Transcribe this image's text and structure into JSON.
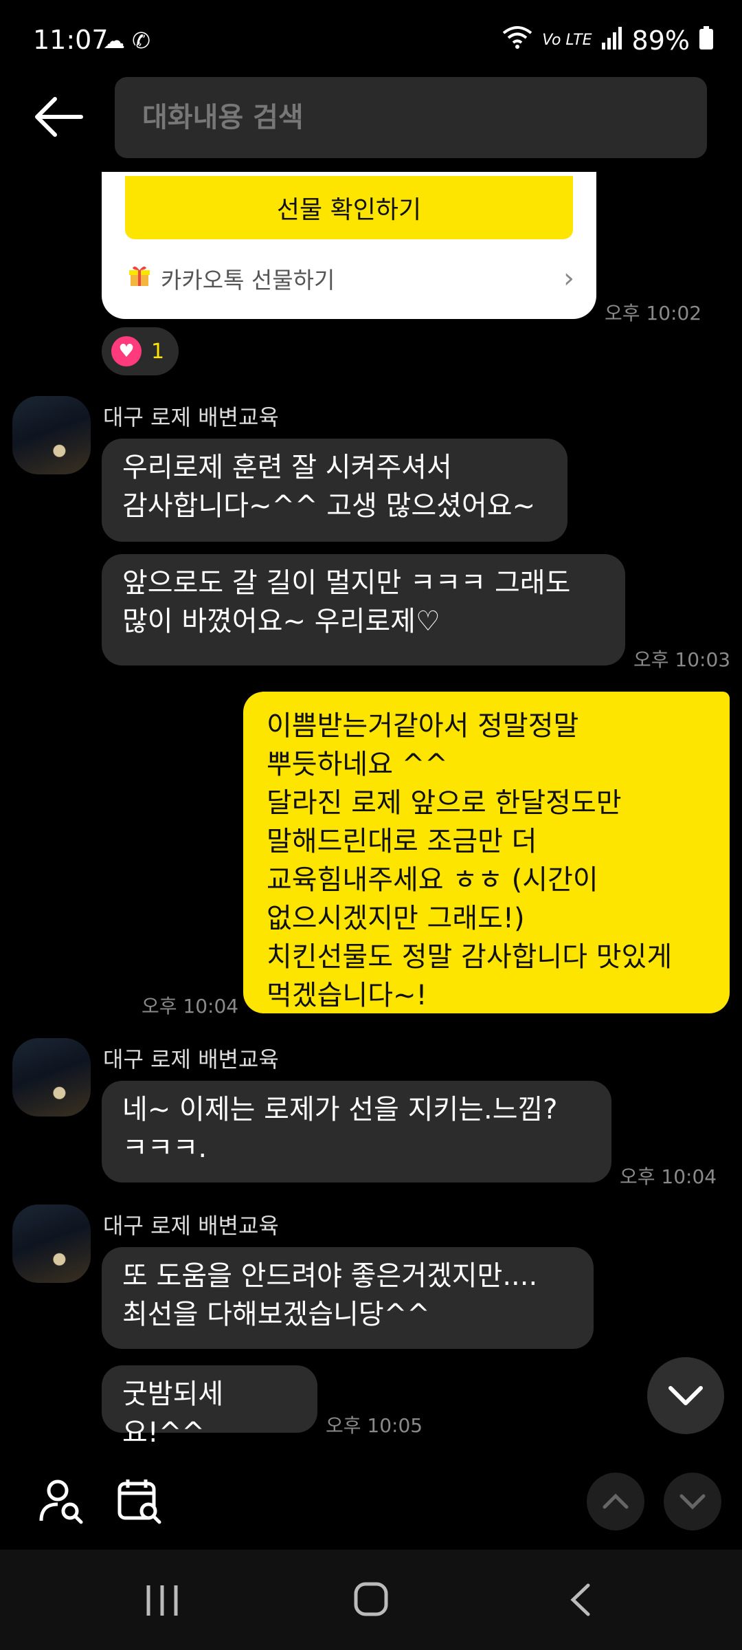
{
  "status": {
    "time": "11:07",
    "battery": "89%",
    "network": "Vo LTE"
  },
  "search": {
    "placeholder": "대화내용 검색"
  },
  "gift": {
    "button_label": "선물 확인하기",
    "source_label": "카카오톡 선물하기",
    "time": "오후 10:02",
    "reaction_count": "1"
  },
  "messages": [
    {
      "sender": "대구 로제 배변교육",
      "text": "우리로제 훈련 잘 시켜주셔서\n감사합니다~^^ 고생 많으셨어요~"
    },
    {
      "text": "앞으로도 갈 길이 멀지만 ㅋㅋㅋ 그래도\n많이 바꼈어요~ 우리로제♡",
      "time": "오후 10:03"
    },
    {
      "text": "이쁨받는거같아서 정말정말\n뿌듯하네요 ^^\n달라진 로제 앞으로 한달정도만\n말해드린대로 조금만 더\n교육힘내주세요 ㅎㅎ (시간이\n없으시겠지만 그래도!)\n치킨선물도 정말 감사합니다 맛있게\n먹겠습니다~!",
      "time": "오후 10:04"
    },
    {
      "sender": "대구 로제 배변교육",
      "text": "네~ 이제는 로제가 선을 지키는.느낌?\nㅋㅋㅋ.",
      "time": "오후 10:04"
    },
    {
      "sender": "대구 로제 배변교육",
      "text": "또 도움을 안드려야 좋은거겠지만....\n최선을 다해보겠습니당^^"
    },
    {
      "text": "굿밤되세요!^^",
      "time": "오후 10:05"
    }
  ],
  "colors": {
    "my_bubble": "#fee500",
    "other_bubble": "#2c2c2c",
    "background": "#000000"
  }
}
